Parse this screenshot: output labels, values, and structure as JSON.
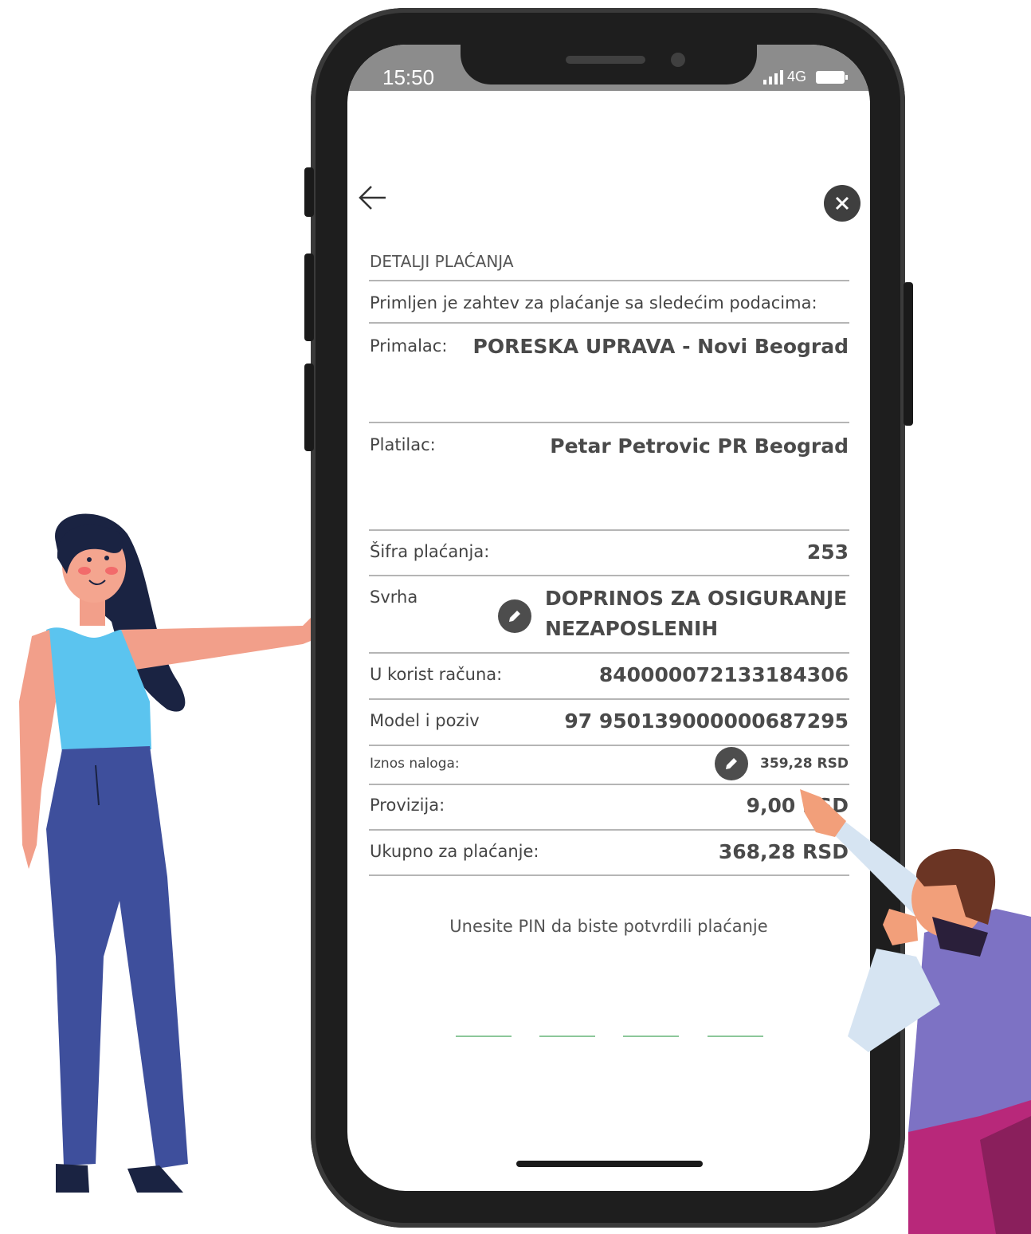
{
  "status_bar": {
    "time": "15:50",
    "network": "4G"
  },
  "header": {
    "back_label": "←",
    "close_label": "✕"
  },
  "payment": {
    "section_title": "DETALJI PLAĆANJA",
    "intro": "Primljen je zahtev za plaćanje sa sledećim podacima:",
    "recipient_label": "Primalac:",
    "recipient_value": "PORESKA UPRAVA - Novi Beograd",
    "payer_label": "Platilac:",
    "payer_value": "Petar Petrovic PR Beograd",
    "code_label": "Šifra plaćanja:",
    "code_value": "253",
    "purpose_label": "Svrha",
    "purpose_line1": "DOPRINOS ZA OSIGURANJE",
    "purpose_line2": "NEZAPOSLENIH",
    "account_label": "U korist računa:",
    "account_value": "840000072133184306",
    "model_label": "Model i poziv",
    "model_value": "97 950139000000687295",
    "amount_label": "Iznos naloga:",
    "amount_value": "359,28 RSD",
    "fee_label": "Provizija:",
    "fee_value": "9,00 RSD",
    "total_label": "Ukupno za plaćanje:",
    "total_value": "368,28 RSD"
  },
  "pin": {
    "prompt": "Unesite PIN da biste potvrdili plaćanje",
    "digits": 4
  },
  "icons": {
    "back": "arrow-left-icon",
    "close": "close-icon",
    "edit": "pencil-icon"
  },
  "colors": {
    "accent_green": "#8cc79a",
    "text_dark": "#4a4a4a",
    "frame": "#1e1e1e"
  }
}
